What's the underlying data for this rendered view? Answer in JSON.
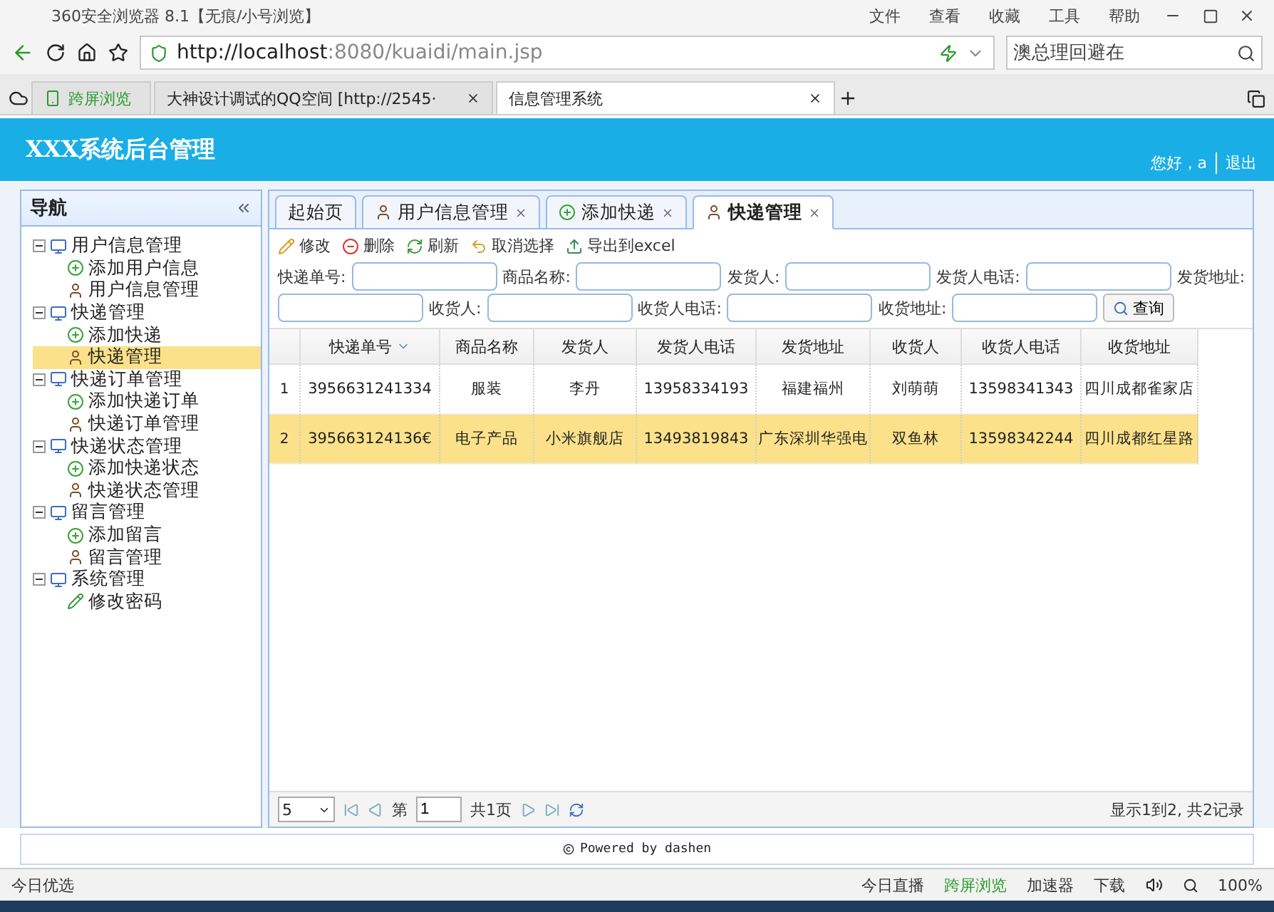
{
  "browser": {
    "title": "360安全浏览器 8.1【无痕/小号浏览】",
    "menu": [
      "文件",
      "查看",
      "收藏",
      "工具",
      "帮助"
    ],
    "url_host": "http://localhost",
    "url_path": ":8080/kuaidi/main.jsp",
    "search_value": "澳总理回避在",
    "tabs": [
      {
        "label": "跨屏浏览",
        "kind": "special",
        "selected": false
      },
      {
        "label": "大神设计调试的QQ空间 [http://2545·",
        "kind": "page",
        "selected": false
      },
      {
        "label": "信息管理系统",
        "kind": "page",
        "selected": true
      }
    ]
  },
  "header": {
    "title": "XXX系统后台管理",
    "greeting": "您好，a",
    "logout": "退出"
  },
  "sidebar": {
    "title": "导航",
    "items": [
      {
        "label": "用户信息管理",
        "kind": "folder",
        "expanded": true,
        "selected": false,
        "children": [
          {
            "label": "添加用户信息",
            "kind": "add",
            "selected": false
          },
          {
            "label": "用户信息管理",
            "kind": "user",
            "selected": false
          }
        ]
      },
      {
        "label": "快递管理",
        "kind": "folder",
        "expanded": true,
        "selected": false,
        "children": [
          {
            "label": "添加快递",
            "kind": "add",
            "selected": false
          },
          {
            "label": "快递管理",
            "kind": "user",
            "selected": true
          }
        ]
      },
      {
        "label": "快递订单管理",
        "kind": "folder",
        "expanded": true,
        "selected": false,
        "children": [
          {
            "label": "添加快递订单",
            "kind": "add",
            "selected": false
          },
          {
            "label": "快递订单管理",
            "kind": "user",
            "selected": false
          }
        ]
      },
      {
        "label": "快递状态管理",
        "kind": "folder",
        "expanded": true,
        "selected": false,
        "children": [
          {
            "label": "添加快递状态",
            "kind": "add",
            "selected": false
          },
          {
            "label": "快递状态管理",
            "kind": "user",
            "selected": false
          }
        ]
      },
      {
        "label": "留言管理",
        "kind": "folder",
        "expanded": true,
        "selected": false,
        "children": [
          {
            "label": "添加留言",
            "kind": "add",
            "selected": false
          },
          {
            "label": "留言管理",
            "kind": "user",
            "selected": false
          }
        ]
      },
      {
        "label": "系统管理",
        "kind": "folder",
        "expanded": true,
        "selected": false,
        "children": [
          {
            "label": "修改密码",
            "kind": "edit",
            "selected": false
          }
        ]
      }
    ]
  },
  "content_tabs": [
    {
      "label": "起始页",
      "kind": "plain",
      "closable": false,
      "selected": false
    },
    {
      "label": "用户信息管理",
      "kind": "user",
      "closable": true,
      "selected": false
    },
    {
      "label": "添加快递",
      "kind": "add",
      "closable": true,
      "selected": false
    },
    {
      "label": "快递管理",
      "kind": "user",
      "closable": true,
      "selected": true
    }
  ],
  "toolbar": [
    {
      "label": "修改",
      "kind": "edit"
    },
    {
      "label": "删除",
      "kind": "delete"
    },
    {
      "label": "刷新",
      "kind": "refresh"
    },
    {
      "label": "取消选择",
      "kind": "undo"
    },
    {
      "label": "导出到excel",
      "kind": "export"
    }
  ],
  "search": {
    "fields": [
      "快递单号:",
      "商品名称:",
      "发货人:",
      "发货人电话:",
      "发货地址:",
      "收货人:",
      "收货人电话:",
      "收货地址:"
    ],
    "button": "查询"
  },
  "table": {
    "columns": [
      "快递单号",
      "商品名称",
      "发货人",
      "发货人电话",
      "发货地址",
      "收货人",
      "收货人电话",
      "收货地址"
    ],
    "rows": [
      {
        "num": "1",
        "selected": false,
        "cells": [
          "3956631241334",
          "服装",
          "李丹",
          "13958334193",
          "福建福州",
          "刘萌萌",
          "13598341343",
          "四川成都雀家店"
        ]
      },
      {
        "num": "2",
        "selected": true,
        "cells": [
          "395663124136€",
          "电子产品",
          "小米旗舰店",
          "13493819843",
          "广东深圳华强电",
          "双鱼林",
          "13598342244",
          "四川成都红星路"
        ]
      }
    ]
  },
  "pager": {
    "page_size": "5",
    "page_label": "第",
    "page": "1",
    "total_pages": "共1页",
    "summary": "显示1到2, 共2记录"
  },
  "footer": "Powered by dashen",
  "status_bar": {
    "left": "今日优选",
    "items": [
      "今日直播",
      "跨屏浏览",
      "加速器",
      "下载"
    ],
    "zoom": "100%"
  }
}
